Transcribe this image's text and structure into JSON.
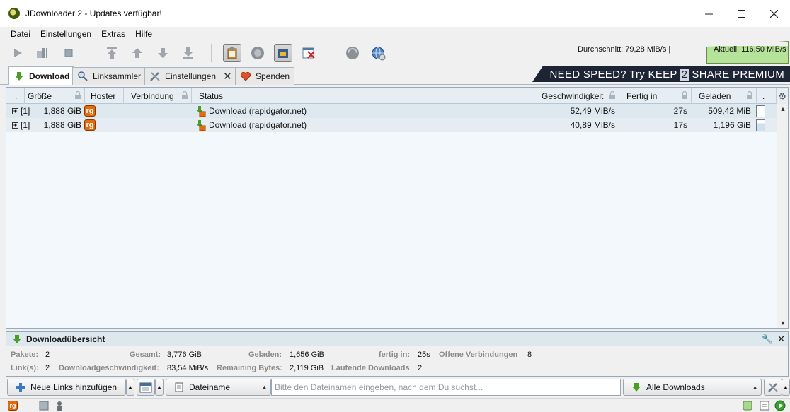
{
  "window": {
    "title": "JDownloader 2 - Updates verfügbar!"
  },
  "menu": [
    "Datei",
    "Einstellungen",
    "Extras",
    "Hilfe"
  ],
  "toolbar": {
    "avg_speed": "Durchschnitt: 79,28 MiB/s |",
    "current_speed": "Aktuell: 116,50 MiB/s"
  },
  "tabs": [
    {
      "label": "Download",
      "active": true
    },
    {
      "label": "Linksammler",
      "active": false
    },
    {
      "label": "Einstellungen",
      "active": false
    },
    {
      "label": "Spenden",
      "active": false
    }
  ],
  "ad": {
    "prefix": "NEED SPEED? Try KEEP",
    "number": "2",
    "suffix": "SHARE PREMIUM"
  },
  "table": {
    "columns": {
      "dot": ".",
      "size": "Größe",
      "hoster": "Hoster",
      "connection": "Verbindung",
      "status": "Status",
      "speed": "Geschwindigkeit",
      "eta": "Fertig in",
      "loaded": "Geladen",
      "dot2": "."
    },
    "rows": [
      {
        "count": "[1]",
        "size": "1,888 GiB",
        "hoster_icon": "rapidgator-icon",
        "status": "Download (rapidgator.net)",
        "speed": "52,49 MiB/s",
        "eta": "27s",
        "loaded": "509,42 MiB"
      },
      {
        "count": "[1]",
        "size": "1,888 GiB",
        "hoster_icon": "rapidgator-icon",
        "status": "Download (rapidgator.net)",
        "speed": "40,89 MiB/s",
        "eta": "17s",
        "loaded": "1,196 GiB"
      }
    ]
  },
  "overview": {
    "title": "Downloadübersicht",
    "packages_label": "Pakete:",
    "packages": "2",
    "total_label": "Gesamt:",
    "total": "3,776 GiB",
    "loaded_label": "Geladen:",
    "loaded": "1,656 GiB",
    "eta_label": "fertig in:",
    "eta": "25s",
    "open_conn_label": "Offene Verbindungen",
    "open_conn": "8",
    "links_label": "Link(s):",
    "links": "2",
    "speed_label": "Downloadgeschwindigkeit:",
    "speed": "83,54 MiB/s",
    "remaining_label": "Remaining Bytes:",
    "remaining": "2,119 GiB",
    "running_label": "Laufende Downloads",
    "running": "2"
  },
  "bottom": {
    "add_links": "Neue Links hinzufügen",
    "filename_select": "Dateiname",
    "search_placeholder": "Bitte den Dateinamen eingeben, nach dem Du suchst...",
    "filter_select": "Alle Downloads"
  },
  "colors": {
    "accent_green": "#4a9d25",
    "rapidgator_orange": "#e36b0c",
    "table_bg": "#f2f8fb"
  }
}
